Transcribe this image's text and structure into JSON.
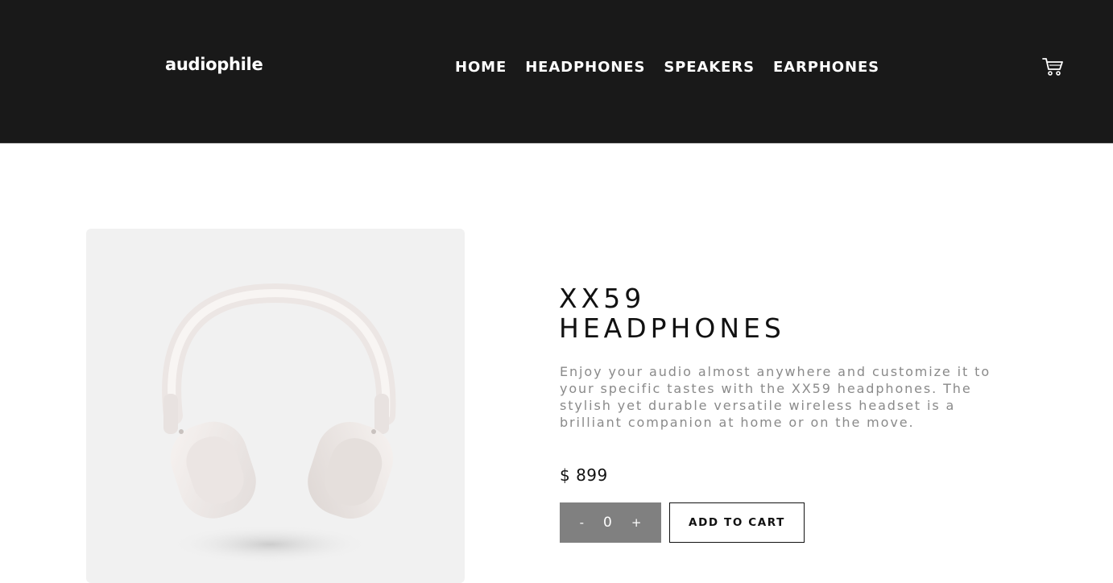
{
  "header": {
    "logo": "audiophile",
    "nav": [
      {
        "label": "HOME"
      },
      {
        "label": "HEADPHONES"
      },
      {
        "label": "SPEAKERS"
      },
      {
        "label": "EARPHONES"
      }
    ],
    "cart_icon": "shopping-cart-icon",
    "background_color": "#191919"
  },
  "product": {
    "title_line1": "XX59",
    "title_line2": "HEADPHONES",
    "description": "Enjoy your audio almost anywhere and customize it to your specific tastes with the XX59 headphones. The stylish yet durable versatile wireless headset is a brilliant companion at home or on the move.",
    "price": "$ 899",
    "image_icon": "white-headphones-image",
    "quantity": {
      "decrement": "-",
      "value": "0",
      "increment": "+"
    },
    "add_to_cart_label": "ADD TO CART"
  },
  "colors": {
    "accent_gray": "#808080",
    "image_bg": "#f1f1f1",
    "text_muted": "#8a8a8a"
  }
}
